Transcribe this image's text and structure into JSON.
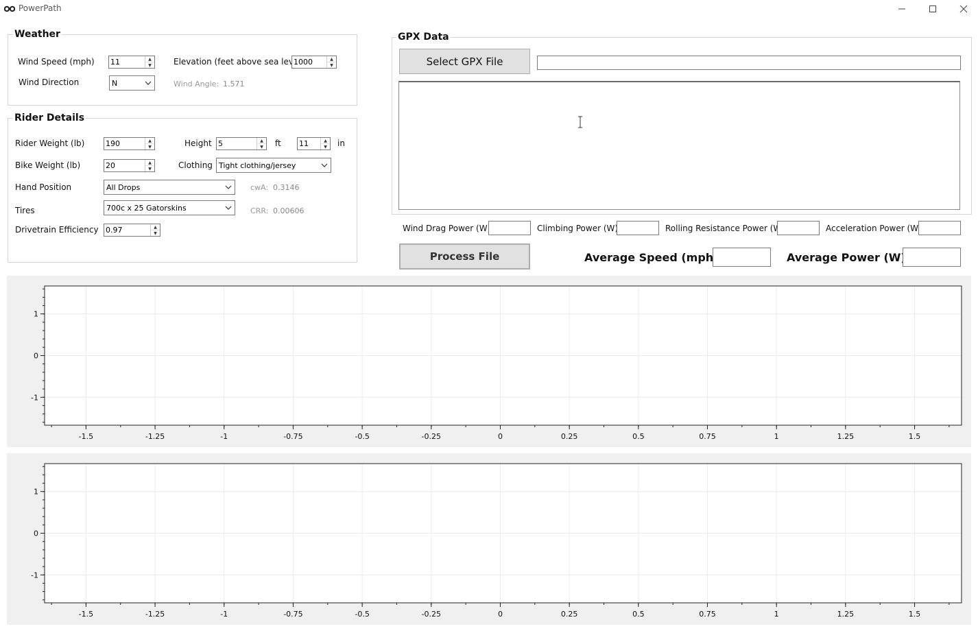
{
  "window": {
    "title": "PowerPath",
    "minimize_icon": "minimize-icon",
    "maximize_icon": "maximize-icon",
    "close_icon": "close-icon"
  },
  "weather": {
    "title": "Weather",
    "wind_speed_label": "Wind Speed (mph)",
    "wind_speed_value": "11",
    "elevation_label": "Elevation (feet above sea level)",
    "elevation_value": "1000",
    "wind_direction_label": "Wind Direction",
    "wind_direction_value": "N",
    "wind_angle_label": "Wind Angle:",
    "wind_angle_value": "1.571"
  },
  "rider": {
    "title": "Rider Details",
    "rider_weight_label": "Rider Weight (lb)",
    "rider_weight_value": "190",
    "height_label": "Height",
    "height_ft_value": "5",
    "ft_label": "ft",
    "height_in_value": "11",
    "in_label": "in",
    "bike_weight_label": "Bike Weight (lb)",
    "bike_weight_value": "20",
    "clothing_label": "Clothing",
    "clothing_value": "Tight clothing/jersey",
    "hand_position_label": "Hand Position",
    "hand_position_value": "All Drops",
    "cwa_label": "cwA:",
    "cwa_value": "0.3146",
    "tires_label": "Tires",
    "tires_value": "700c x 25 Gatorskins",
    "crr_label": "CRR:",
    "crr_value": "0.00606",
    "drivetrain_label": "Drivetrain Efficiency",
    "drivetrain_value": "0.97"
  },
  "gpx": {
    "title": "GPX Data",
    "select_button": "Select GPX File",
    "file_path": "",
    "content": ""
  },
  "powers": {
    "wind_drag_label": "Wind Drag Power (W)",
    "wind_drag_value": "",
    "climbing_label": "Climbing Power (W)",
    "climbing_value": "",
    "rolling_label": "Rolling Resistance Power (W)",
    "rolling_value": "",
    "acceleration_label": "Acceleration Power (W)",
    "acceleration_value": ""
  },
  "process": {
    "button": "Process File",
    "avg_speed_label": "Average Speed (mph)",
    "avg_speed_value": "",
    "avg_power_label": "Average Power (W)",
    "avg_power_value": ""
  },
  "chart_data": [
    {
      "type": "line",
      "title": "",
      "xlabel": "",
      "ylabel": "",
      "xlim": [
        -1.65,
        1.67
      ],
      "ylim": [
        -1.67,
        1.67
      ],
      "xticks": [
        "-1.5",
        "-1.25",
        "-1",
        "-0.75",
        "-0.5",
        "-0.25",
        "0",
        "0.25",
        "0.5",
        "0.75",
        "1",
        "1.25",
        "1.5"
      ],
      "xtick_values": [
        -1.5,
        -1.25,
        -1,
        -0.75,
        -0.5,
        -0.25,
        0,
        0.25,
        0.5,
        0.75,
        1,
        1.25,
        1.5
      ],
      "yticks": [
        "1",
        "0",
        "-1"
      ],
      "ytick_values": [
        1,
        0,
        -1
      ],
      "grid": true,
      "series": []
    },
    {
      "type": "line",
      "title": "",
      "xlabel": "",
      "ylabel": "",
      "xlim": [
        -1.65,
        1.67
      ],
      "ylim": [
        -1.67,
        1.67
      ],
      "xticks": [
        "-1.5",
        "-1.25",
        "-1",
        "-0.75",
        "-0.5",
        "-0.25",
        "0",
        "0.25",
        "0.5",
        "0.75",
        "1",
        "1.25",
        "1.5"
      ],
      "xtick_values": [
        -1.5,
        -1.25,
        -1,
        -0.75,
        -0.5,
        -0.25,
        0,
        0.25,
        0.5,
        0.75,
        1,
        1.25,
        1.5
      ],
      "yticks": [
        "1",
        "0",
        "-1"
      ],
      "ytick_values": [
        1,
        0,
        -1
      ],
      "grid": true,
      "series": []
    }
  ]
}
